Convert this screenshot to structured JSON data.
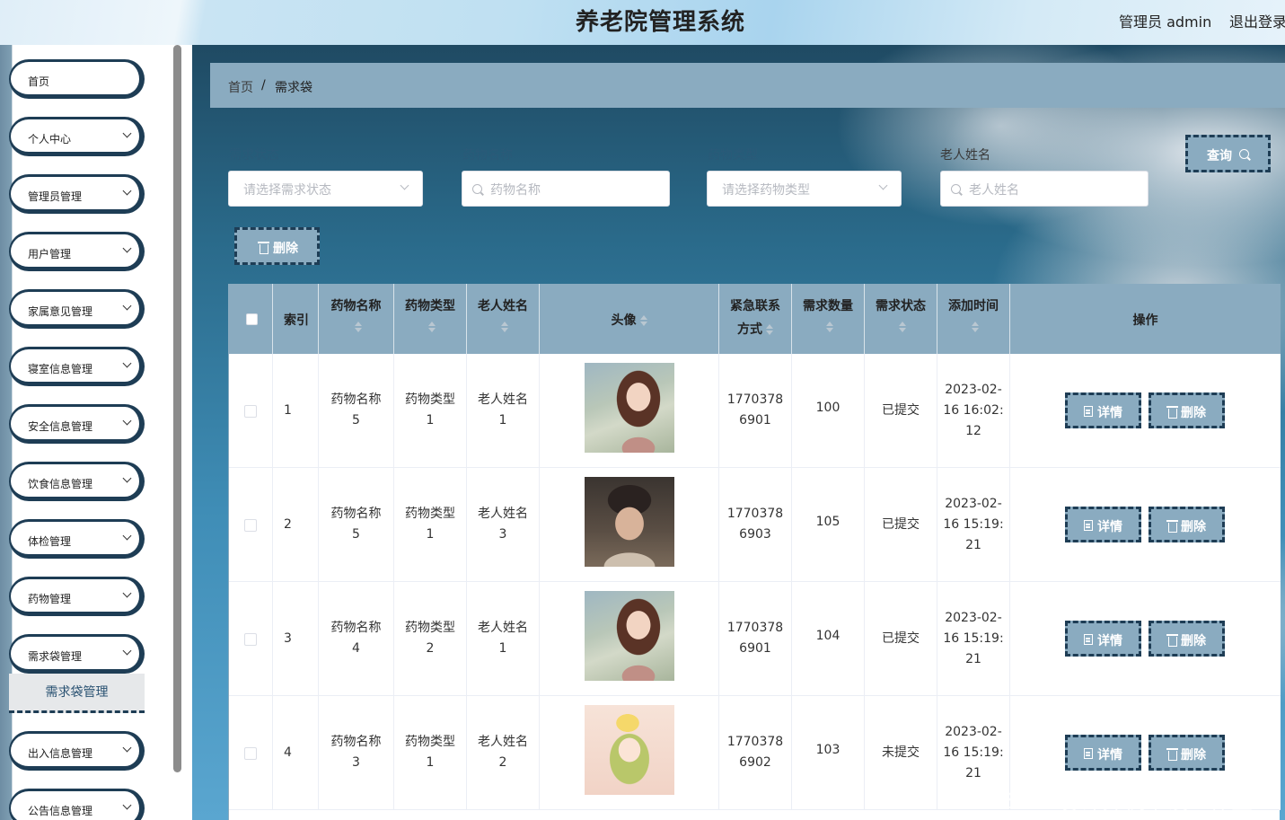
{
  "header": {
    "title": "养老院管理系统",
    "user": "管理员 admin",
    "logout": "退出登录"
  },
  "sidebar": {
    "items": [
      {
        "label": "首页",
        "chevron": false
      },
      {
        "label": "个人中心",
        "chevron": true
      },
      {
        "label": "管理员管理",
        "chevron": true
      },
      {
        "label": "用户管理",
        "chevron": true
      },
      {
        "label": "家属意见管理",
        "chevron": true
      },
      {
        "label": "寝室信息管理",
        "chevron": true
      },
      {
        "label": "安全信息管理",
        "chevron": true
      },
      {
        "label": "饮食信息管理",
        "chevron": true
      },
      {
        "label": "体检管理",
        "chevron": true
      },
      {
        "label": "药物管理",
        "chevron": true
      },
      {
        "label": "需求袋管理",
        "chevron": true
      },
      {
        "label": "出入信息管理",
        "chevron": true
      },
      {
        "label": "公告信息管理",
        "chevron": true
      }
    ],
    "active_sub": "需求袋管理"
  },
  "breadcrumb": {
    "home": "首页",
    "separator": "/",
    "current": "需求袋"
  },
  "filters": {
    "status": {
      "label": "需求状态",
      "placeholder": "请选择需求状态"
    },
    "drug_name": {
      "label": "药物名称",
      "placeholder": "药物名称"
    },
    "drug_type": {
      "label": "药物类型",
      "placeholder": "请选择药物类型"
    },
    "elder_name": {
      "label": "老人姓名",
      "placeholder": "老人姓名"
    },
    "query_button": "查询",
    "delete_button": "删除"
  },
  "table": {
    "headers": {
      "index": "索引",
      "drug_name": "药物名称",
      "drug_type": "药物类型",
      "elder_name": "老人姓名",
      "avatar": "头像",
      "contact_1": "紧急联系",
      "contact_2": "方式",
      "quantity": "需求数量",
      "status": "需求状态",
      "added_time": "添加时间",
      "actions": "操作"
    },
    "rows": [
      {
        "index": "1",
        "drug_name_1": "药物名称",
        "drug_name_2": "5",
        "drug_type_1": "药物类型",
        "drug_type_2": "1",
        "elder_1": "老人姓名",
        "elder_2": "1",
        "avatar": "girl-photo",
        "contact_1": "1770378",
        "contact_2": "6901",
        "quantity": "100",
        "status": "已提交",
        "time_1": "2023-02-",
        "time_2": "16 16:02:",
        "time_3": "12"
      },
      {
        "index": "2",
        "drug_name_1": "药物名称",
        "drug_name_2": "5",
        "drug_type_1": "药物类型",
        "drug_type_2": "1",
        "elder_1": "老人姓名",
        "elder_2": "3",
        "avatar": "boy-photo",
        "contact_1": "1770378",
        "contact_2": "6903",
        "quantity": "105",
        "status": "已提交",
        "time_1": "2023-02-",
        "time_2": "16 15:19:",
        "time_3": "21"
      },
      {
        "index": "3",
        "drug_name_1": "药物名称",
        "drug_name_2": "4",
        "drug_type_1": "药物类型",
        "drug_type_2": "2",
        "elder_1": "老人姓名",
        "elder_2": "1",
        "avatar": "girl-photo",
        "contact_1": "1770378",
        "contact_2": "6901",
        "quantity": "104",
        "status": "已提交",
        "time_1": "2023-02-",
        "time_2": "16 15:19:",
        "time_3": "21"
      },
      {
        "index": "4",
        "drug_name_1": "药物名称",
        "drug_name_2": "3",
        "drug_type_1": "药物类型",
        "drug_type_2": "1",
        "elder_1": "老人姓名",
        "elder_2": "2",
        "avatar": "anime-photo",
        "contact_1": "1770378",
        "contact_2": "6902",
        "quantity": "103",
        "status": "未提交",
        "time_1": "2023-02-",
        "time_2": "16 15:19:",
        "time_3": "21"
      }
    ],
    "detail_label": "详情",
    "delete_label": "删除"
  },
  "watermark": "CSDN @计算机毕设工作室",
  "colors": {
    "accent": "#8aabc0",
    "dark": "#1e3d55"
  }
}
